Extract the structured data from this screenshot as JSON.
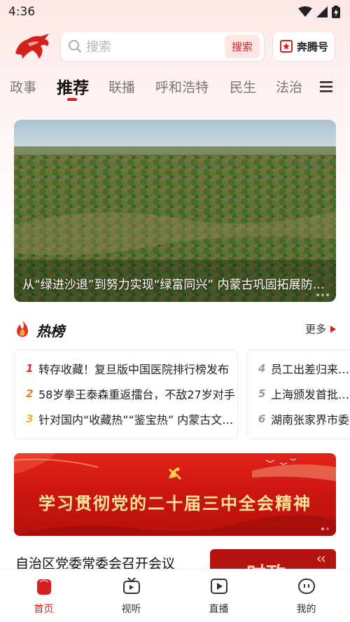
{
  "status_bar": {
    "time": "4:36"
  },
  "header": {
    "search_placeholder": "搜索",
    "search_button": "搜索",
    "benteng_label": "奔腾号"
  },
  "tabs": [
    {
      "label": "政事",
      "active": false
    },
    {
      "label": "推荐",
      "active": true
    },
    {
      "label": "联播",
      "active": false
    },
    {
      "label": "呼和浩特",
      "active": false
    },
    {
      "label": "民生",
      "active": false
    },
    {
      "label": "法治",
      "active": false
    }
  ],
  "hero": {
    "caption": "从“绿进沙退”到努力实现“绿富同兴” 内蒙古巩固拓展防沙治沙成果"
  },
  "hot_list": {
    "title": "热榜",
    "more_label": "更多",
    "col1": [
      {
        "num": "1",
        "text": "转存收藏！复旦版中国医院排行榜发布",
        "color": "#e0302a"
      },
      {
        "num": "2",
        "text": "58岁拳王泰森重返擂台，不敌27岁对手",
        "color": "#f07a1c"
      },
      {
        "num": "3",
        "text": "针对国内“收藏热”“鉴宝热” 内蒙古文物部门提示",
        "color": "#f2b21c"
      }
    ],
    "col2": [
      {
        "num": "4",
        "text": "员工出差归来报销",
        "color": "#999999"
      },
      {
        "num": "5",
        "text": "上海颁发首批数据",
        "color": "#999999"
      },
      {
        "num": "6",
        "text": "湖南张家界市委",
        "color": "#999999"
      }
    ]
  },
  "banner": {
    "text": "学习贯彻党的二十届三中全会精神"
  },
  "news": {
    "title": "自治区党委常委会召开会议",
    "thumb_text": "时政"
  },
  "bottom_nav": [
    {
      "label": "首页",
      "icon": "home-icon",
      "active": true
    },
    {
      "label": "视听",
      "icon": "tv-icon",
      "active": false
    },
    {
      "label": "直播",
      "icon": "live-play-icon",
      "active": false
    },
    {
      "label": "我的",
      "icon": "profile-icon",
      "active": false
    }
  ],
  "colors": {
    "accent": "#d3201c",
    "banner_text": "#ffe59a"
  }
}
